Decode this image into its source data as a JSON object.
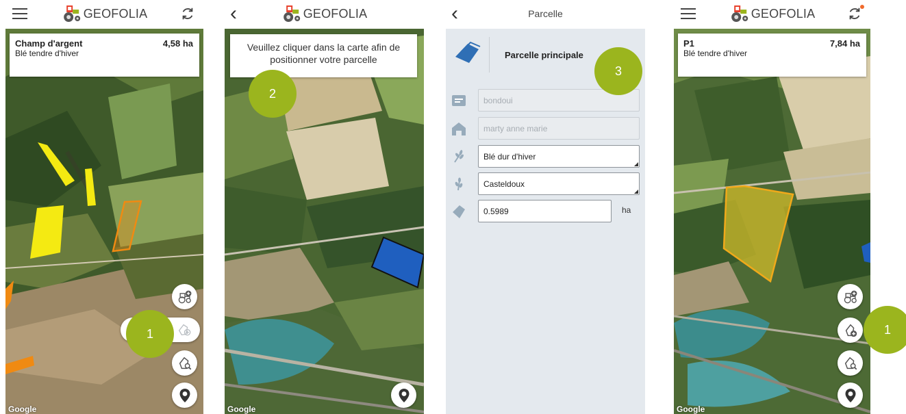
{
  "app": {
    "brand": "GEOFOLIA"
  },
  "screen1": {
    "field_name": "Champ d'argent",
    "crop": "Blé tendre d'hiver",
    "area": "4,58 ha",
    "step": "1",
    "map_credit": "Google"
  },
  "screen2": {
    "instruction": "Veuillez cliquer dans la carte afin de positionner votre parcelle",
    "step": "2",
    "map_credit": "Google"
  },
  "screen3": {
    "page_title": "Parcelle",
    "section_title": "Parcelle principale",
    "step": "3",
    "fields": {
      "name_placeholder": "bondoui",
      "farm_placeholder": "marty anne marie",
      "crop_value": "Blé dur d'hiver",
      "variety_value": "Casteldoux",
      "area_value": "0.5989",
      "area_unit": "ha"
    }
  },
  "screen4": {
    "field_name": "P1",
    "crop": "Blé tendre d'hiver",
    "area": "7,84 ha",
    "step": "1",
    "map_credit": "Google"
  },
  "colors": {
    "accent_green": "#9bb51e",
    "parcel_yellow": "#f4ea12",
    "parcel_orange": "#f08a12",
    "parcel_blue": "#1f5fbf",
    "sync_dot": "#f06a2c"
  },
  "icons": [
    "menu-icon",
    "sync-icon",
    "back-icon",
    "tractor-logo-icon",
    "tractor-add-icon",
    "parcel-draw-icon",
    "parcel-edit-icon",
    "parcel-add-icon",
    "parcel-search-icon",
    "location-pin-icon",
    "text-field-icon",
    "farm-icon",
    "wheat-icon",
    "parcel-shape-icon"
  ]
}
